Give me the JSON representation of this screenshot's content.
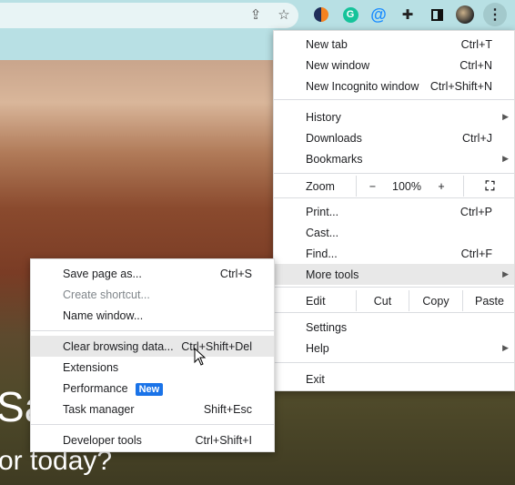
{
  "toolbar": {
    "icons": [
      "share-icon",
      "star-icon",
      "simplenote-extension-icon",
      "grammarly-extension-icon",
      "email-extension-icon",
      "extensions-puzzle-icon",
      "side-panel-icon",
      "profile-avatar",
      "more-menu-icon"
    ]
  },
  "page": {
    "hero_line1": "Sa",
    "hero_line2": "or today?"
  },
  "menu": {
    "new_tab": {
      "label": "New tab",
      "shortcut": "Ctrl+T"
    },
    "new_window": {
      "label": "New window",
      "shortcut": "Ctrl+N"
    },
    "incognito": {
      "label": "New Incognito window",
      "shortcut": "Ctrl+Shift+N"
    },
    "history": {
      "label": "History"
    },
    "downloads": {
      "label": "Downloads",
      "shortcut": "Ctrl+J"
    },
    "bookmarks": {
      "label": "Bookmarks"
    },
    "zoom": {
      "label": "Zoom",
      "minus": "−",
      "value": "100%",
      "plus": "+"
    },
    "print": {
      "label": "Print...",
      "shortcut": "Ctrl+P"
    },
    "cast": {
      "label": "Cast..."
    },
    "find": {
      "label": "Find...",
      "shortcut": "Ctrl+F"
    },
    "more_tools": {
      "label": "More tools"
    },
    "edit": {
      "label": "Edit",
      "cut": "Cut",
      "copy": "Copy",
      "paste": "Paste"
    },
    "settings": {
      "label": "Settings"
    },
    "help": {
      "label": "Help"
    },
    "exit": {
      "label": "Exit"
    }
  },
  "submenu": {
    "save_page": {
      "label": "Save page as...",
      "shortcut": "Ctrl+S"
    },
    "create_shortcut": {
      "label": "Create shortcut..."
    },
    "name_window": {
      "label": "Name window..."
    },
    "clear_browsing": {
      "label": "Clear browsing data...",
      "shortcut": "Ctrl+Shift+Del"
    },
    "extensions": {
      "label": "Extensions"
    },
    "performance": {
      "label": "Performance",
      "badge": "New"
    },
    "task_manager": {
      "label": "Task manager",
      "shortcut": "Shift+Esc"
    },
    "developer_tools": {
      "label": "Developer tools",
      "shortcut": "Ctrl+Shift+I"
    }
  }
}
